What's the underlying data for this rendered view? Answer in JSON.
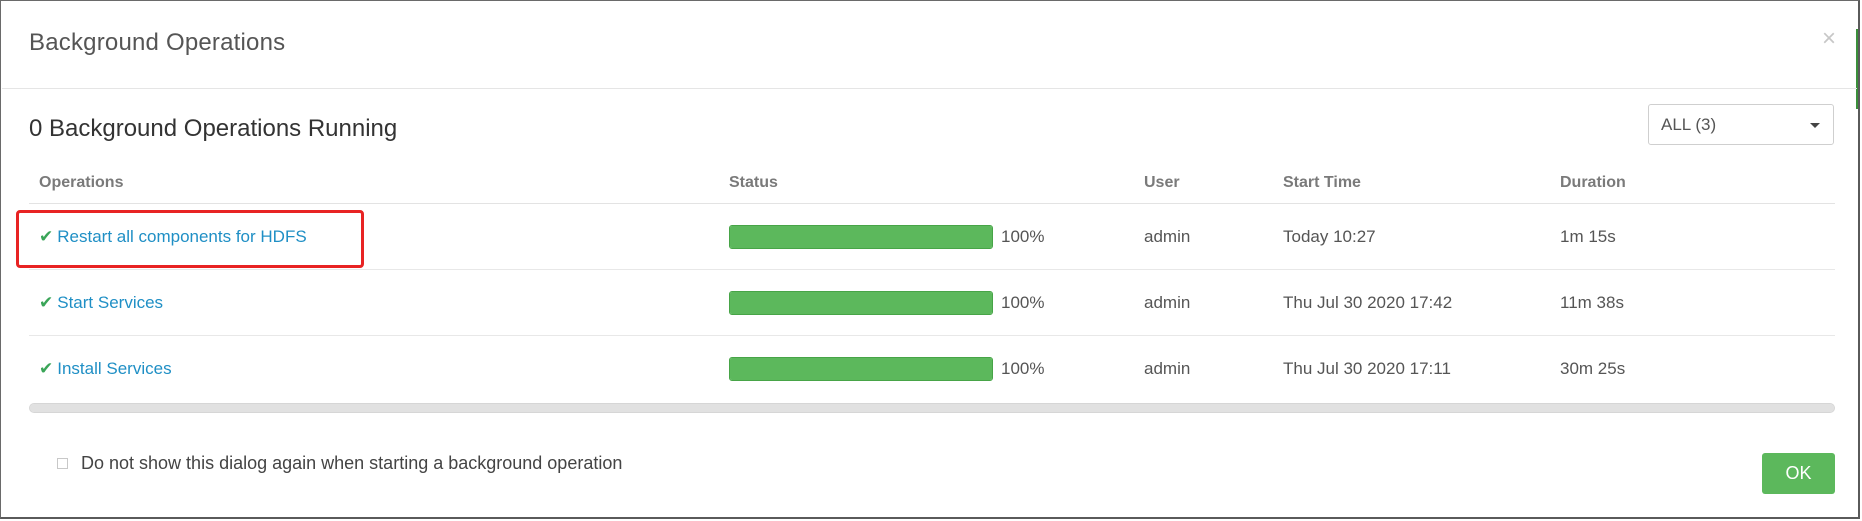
{
  "dialog": {
    "title": "Background Operations",
    "close_glyph": "×",
    "heading": "0 Background Operations Running",
    "filter": {
      "selected": "ALL (3)"
    }
  },
  "table": {
    "headers": [
      "Operations",
      "Status",
      "User",
      "Start Time",
      "Duration"
    ],
    "rows": [
      {
        "operation": "Restart all components for HDFS",
        "progress": 100,
        "progress_label": "100%",
        "user": "admin",
        "start_time": "Today 10:27",
        "duration": "1m 15s"
      },
      {
        "operation": "Start Services",
        "progress": 100,
        "progress_label": "100%",
        "user": "admin",
        "start_time": "Thu Jul 30 2020 17:42",
        "duration": "11m 38s"
      },
      {
        "operation": "Install Services",
        "progress": 100,
        "progress_label": "100%",
        "user": "admin",
        "start_time": "Thu Jul 30 2020 17:11",
        "duration": "30m 25s"
      }
    ]
  },
  "footer": {
    "checkbox_label": "Do not show this dialog again when starting a background operation",
    "ok_label": "OK"
  },
  "colors": {
    "progress": "#5cb85c",
    "link": "#1f8fc5",
    "check": "#3aa558",
    "highlight": "#e82323"
  },
  "icons": {
    "success": "check-icon",
    "close": "close-icon",
    "dropdown": "chevron-down-icon"
  }
}
